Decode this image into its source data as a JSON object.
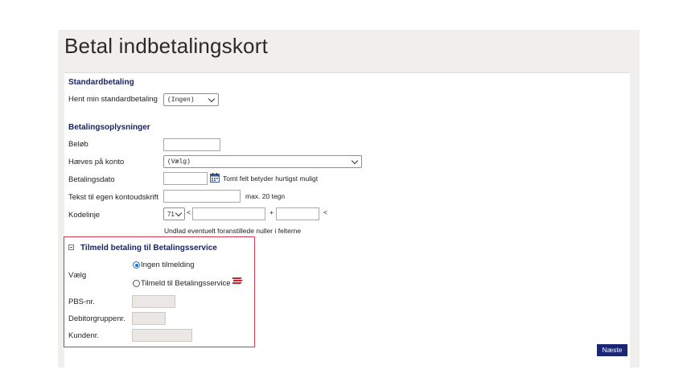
{
  "page": {
    "title": "Betal indbetalingskort"
  },
  "standard": {
    "heading": "Standardbetaling",
    "label": "Hent min standardbetaling",
    "value": "(Ingen)"
  },
  "payment": {
    "heading": "Betalingsoplysninger",
    "amount_label": "Beløb",
    "account_label": "Hæves på konto",
    "account_value": "(Vælg)",
    "date_label": "Betalingsdato",
    "date_hint": "Tomt felt betyder hurtigst muligt",
    "text_label": "Tekst til egen kontoudskrift",
    "text_hint": "max. 20 tegn",
    "code_label": "Kodelinje",
    "code_type": "71",
    "code_lt1": "<",
    "code_plus": "+",
    "code_lt2": "<",
    "code_hint": "Undlad eventuelt foranstillede nuller i felterne"
  },
  "pbs": {
    "heading": "Tilmeld betaling til Betalingsservice",
    "choose_label": "Vælg",
    "option_none": "Ingen tilmelding",
    "option_signup": "Tilmeld til Betalingsservice",
    "selected": "option_none",
    "pbs_nr_label": "PBS-nr.",
    "debitor_label": "Debitorgruppenr.",
    "customer_label": "Kundenr."
  },
  "actions": {
    "next_label": "Næste"
  },
  "colors": {
    "navy": "#1a2672",
    "highlight_border": "#d23a52",
    "bs_logo": "#d0202e"
  }
}
